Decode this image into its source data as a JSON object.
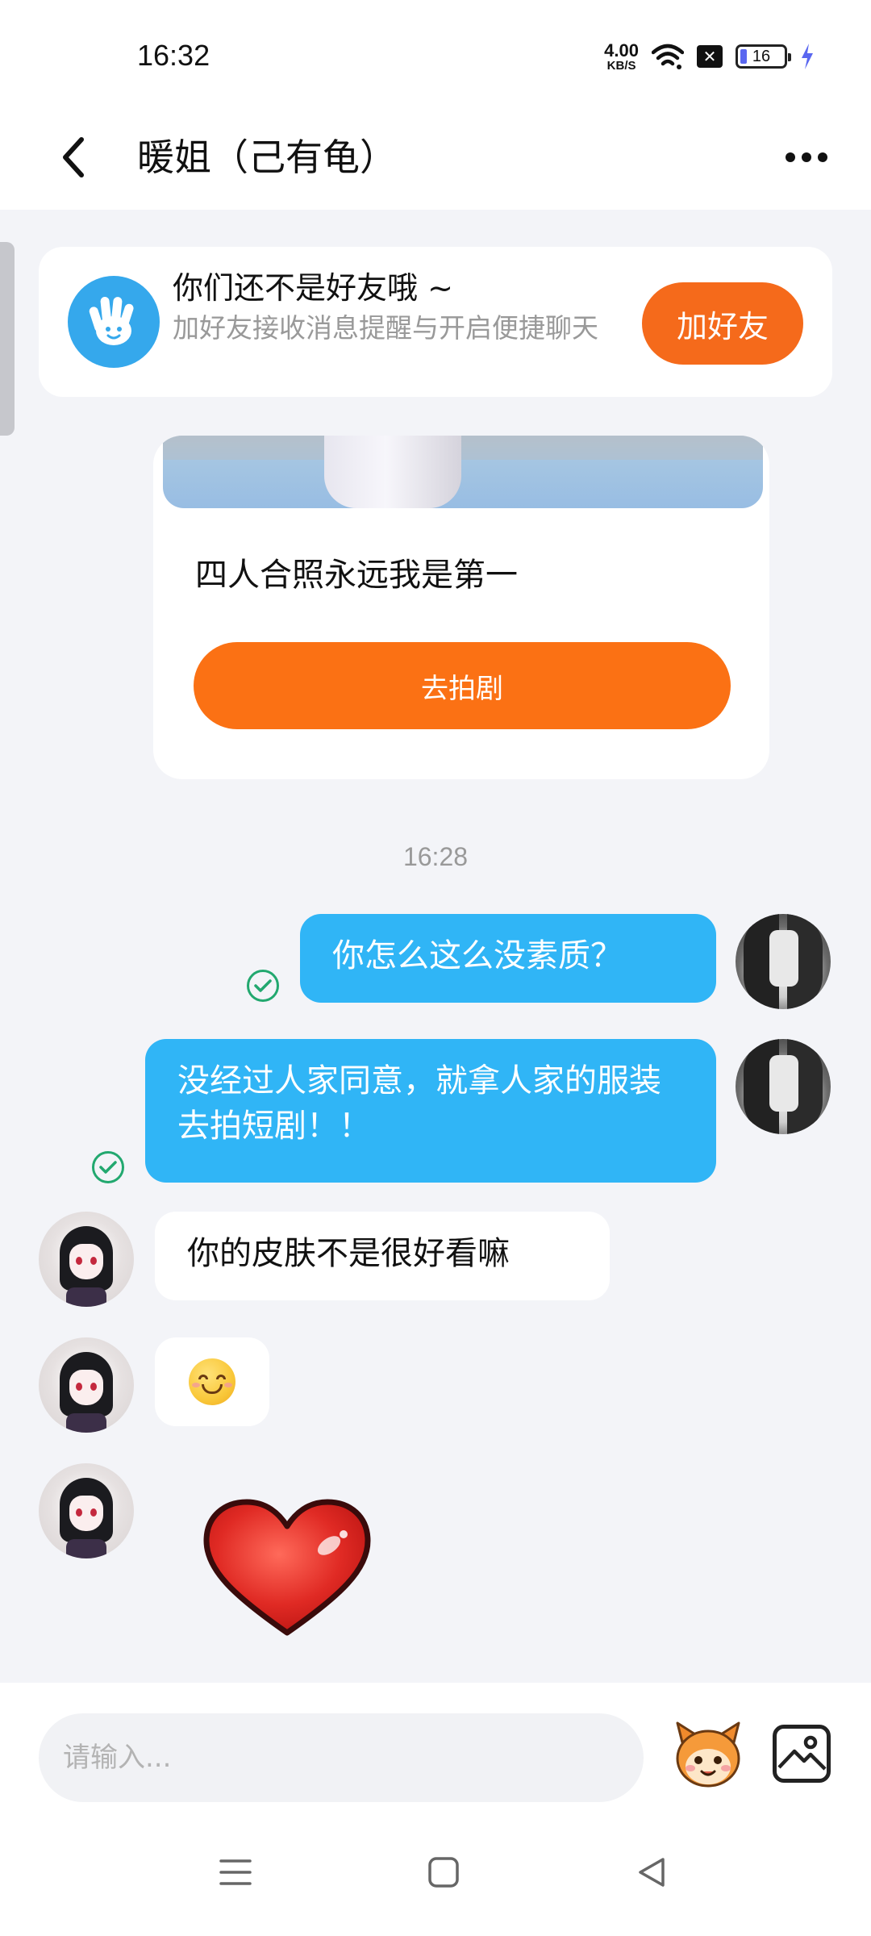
{
  "status_bar": {
    "time": "16:32",
    "net_speed_value": "4.00",
    "net_speed_unit": "KB/S",
    "battery_level": "16",
    "icons": [
      "wifi-icon",
      "no-sim-icon",
      "battery-icon",
      "charging-icon"
    ]
  },
  "header": {
    "title": "暖姐（己有龟）",
    "back_icon": "back-chevron-icon",
    "more_icon": "more-dots-icon"
  },
  "friend_banner": {
    "title": "你们还不是好友哦 ~",
    "subtitle": "加好友接收消息提醒与开启便捷聊天",
    "add_button": "加好友",
    "icon": "hand-wave-icon"
  },
  "drama_card": {
    "title": "四人合照永远我是第一",
    "button": "去拍剧"
  },
  "time_separator": "16:28",
  "messages": [
    {
      "side": "me",
      "type": "text",
      "text": "你怎么这么没素质？",
      "status": "read"
    },
    {
      "side": "me",
      "type": "text",
      "text": "没经过人家同意，就拿人家的服装去拍短剧！！",
      "status": "read"
    },
    {
      "side": "her",
      "type": "text",
      "text": "你的皮肤不是很好看嘛"
    },
    {
      "side": "her",
      "type": "emoji",
      "emoji": "smile-emoji"
    },
    {
      "side": "her",
      "type": "sticker",
      "sticker": "red-heart-sticker"
    }
  ],
  "input_bar": {
    "placeholder": "请输入...",
    "sticker_icon": "mascot-sticker-icon",
    "image_icon": "image-picker-icon"
  },
  "nav_bar": {
    "icons": [
      "menu-icon",
      "home-square-icon",
      "back-triangle-icon"
    ]
  },
  "colors": {
    "accent_orange": "#fb7114",
    "my_bubble": "#30b5f6",
    "read_check": "#22a86f",
    "banner_icon_bg": "#35a8ec"
  }
}
